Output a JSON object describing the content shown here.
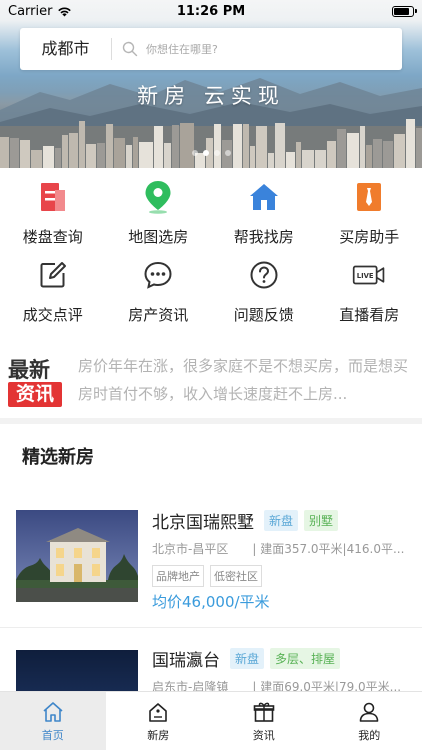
{
  "status": {
    "carrier": "Carrier",
    "time": "11:26 PM",
    "battery_level": 0.9
  },
  "search": {
    "city": "成都市",
    "placeholder": "你想住在哪里?"
  },
  "banner": {
    "slogan": "新房  云实现",
    "page_count": 4,
    "active_page": 1
  },
  "functions": [
    {
      "label": "楼盘查询",
      "icon": "building-list-icon",
      "color": "#e8454a"
    },
    {
      "label": "地图选房",
      "icon": "map-pin-icon",
      "color": "#2fbd5e"
    },
    {
      "label": "帮我找房",
      "icon": "house-icon",
      "color": "#3a83db"
    },
    {
      "label": "买房助手",
      "icon": "assistant-tie-icon",
      "color": "#f07c2c"
    },
    {
      "label": "成交点评",
      "icon": "edit-icon",
      "color": "#333333"
    },
    {
      "label": "房产资讯",
      "icon": "chat-bubble-icon",
      "color": "#333333"
    },
    {
      "label": "问题反馈",
      "icon": "question-icon",
      "color": "#333333"
    },
    {
      "label": "直播看房",
      "icon": "live-camera-icon",
      "color": "#333333"
    }
  ],
  "news": {
    "logo_top": "最新",
    "logo_bottom": "资讯",
    "text": "房价年年在涨，很多家庭不是不想买房，而是想买房时首付不够，收入增长速度赶不上房..."
  },
  "section_title": "精选新房",
  "houses": [
    {
      "name": "北京国瑞熙墅",
      "tags": [
        {
          "text": "新盘",
          "style": "blue"
        },
        {
          "text": "别墅",
          "style": "green"
        }
      ],
      "location": "北京市-昌平区",
      "area": "| 建面357.0平米|416.0平...",
      "features": [
        "品牌地产",
        "低密社区"
      ],
      "price": "均价46,000/平米"
    },
    {
      "name": "国瑞瀛台",
      "tags": [
        {
          "text": "新盘",
          "style": "blue"
        },
        {
          "text": "多层、排屋",
          "style": "green"
        }
      ],
      "location": "启东市-启隆镇",
      "area": "| 建面69.0平米|79.0平米...",
      "features": [],
      "price": ""
    }
  ],
  "tabs": [
    {
      "label": "首页",
      "icon": "home-icon",
      "active": true
    },
    {
      "label": "新房",
      "icon": "new-house-tag-icon",
      "active": false
    },
    {
      "label": "资讯",
      "icon": "gift-news-icon",
      "active": false
    },
    {
      "label": "我的",
      "icon": "profile-icon",
      "active": false
    }
  ]
}
